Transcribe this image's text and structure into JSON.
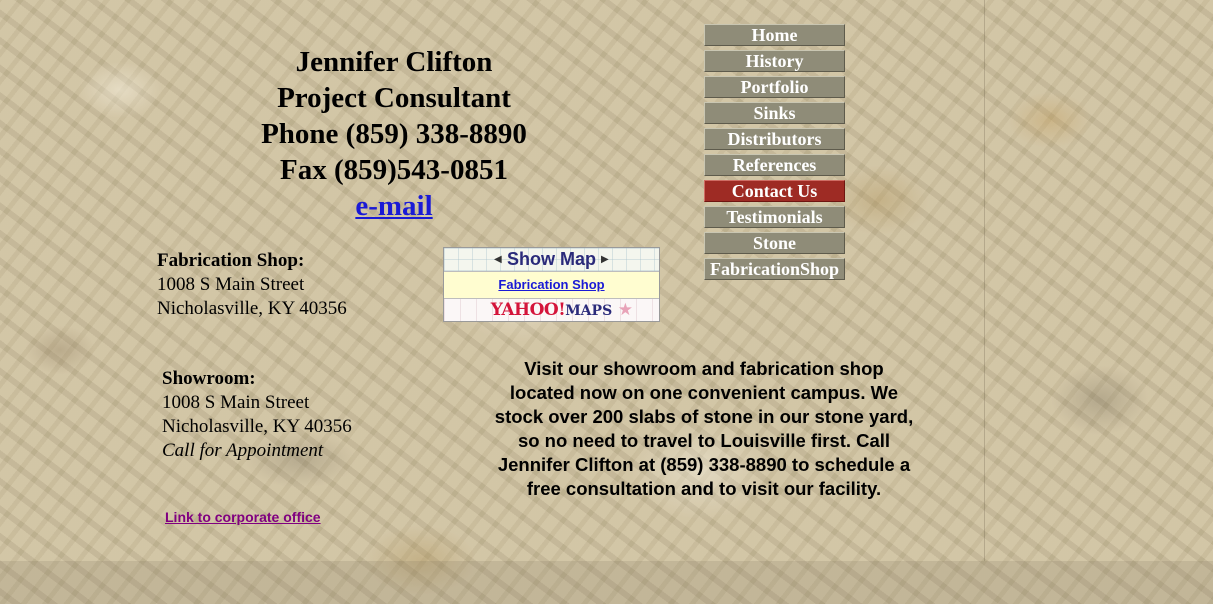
{
  "contact": {
    "name": "Jennifer Clifton",
    "title": "Project Consultant",
    "phone": "Phone (859) 338-8890",
    "fax": "Fax (859)543-0851",
    "email_label": "e-mail"
  },
  "fabrication_shop": {
    "heading": "Fabrication Shop:",
    "street": "1008 S Main Street",
    "city": "Nicholasville, KY  40356"
  },
  "showroom": {
    "heading": "Showroom:",
    "street": "1008 S Main Street",
    "city": "Nicholasville, KY  40356",
    "note": "Call for Appointment"
  },
  "map_widget": {
    "show_map_label": "Show Map",
    "location_link": "Fabrication Shop",
    "brand_yahoo": "YAHOO!",
    "brand_maps": "MAPS"
  },
  "nav": {
    "active_color": "#9e2b24",
    "items": [
      {
        "label": "Home"
      },
      {
        "label": "History"
      },
      {
        "label": "Portfolio"
      },
      {
        "label": "Sinks"
      },
      {
        "label": "Distributors"
      },
      {
        "label": "References"
      },
      {
        "label": "Contact Us",
        "active": true
      },
      {
        "label": "Testimonials"
      },
      {
        "label": "Stone"
      },
      {
        "label": "FabricationShop"
      }
    ]
  },
  "promo_text": "Visit our showroom and fabrication shop located now on one convenient campus.  We stock over 200 slabs of stone in our stone yard, so no need to travel to Louisville first.  Call Jennifer Clifton at (859) 338-8890 to schedule a free consultation and to visit our facility.",
  "corporate_link": "Link to corporate office"
}
